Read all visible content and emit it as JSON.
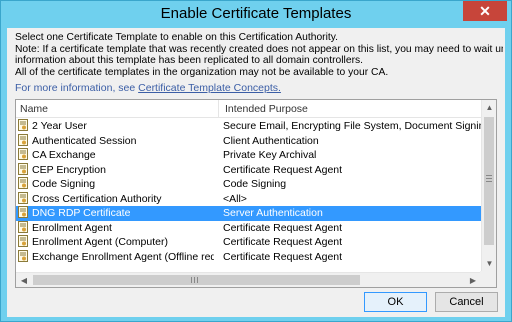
{
  "window": {
    "title": "Enable Certificate Templates",
    "close_glyph": "✕"
  },
  "description": {
    "lines": [
      "Select one Certificate Template to enable on this Certification Authority.",
      "Note: If a certificate template that was recently created does not appear on this list, you may need to wait until",
      "information about this template has been replicated to all domain controllers.",
      "All of the certificate templates in the organization may not be available to your CA."
    ],
    "more_info_prefix": "For more information, see ",
    "more_info_link": "Certificate Template Concepts."
  },
  "list": {
    "columns": [
      "Name",
      "Intended Purpose"
    ],
    "rows": [
      {
        "name": "2 Year User",
        "purpose": "Secure Email, Encrypting File System, Document Signing, Doc",
        "selected": false
      },
      {
        "name": "Authenticated Session",
        "purpose": "Client Authentication",
        "selected": false
      },
      {
        "name": "CA Exchange",
        "purpose": "Private Key Archival",
        "selected": false
      },
      {
        "name": "CEP Encryption",
        "purpose": "Certificate Request Agent",
        "selected": false
      },
      {
        "name": "Code Signing",
        "purpose": "Code Signing",
        "selected": false
      },
      {
        "name": "Cross Certification Authority",
        "purpose": "<All>",
        "selected": false
      },
      {
        "name": "DNG RDP Certificate",
        "purpose": "Server Authentication",
        "selected": true
      },
      {
        "name": "Enrollment Agent",
        "purpose": "Certificate Request Agent",
        "selected": false
      },
      {
        "name": "Enrollment Agent (Computer)",
        "purpose": "Certificate Request Agent",
        "selected": false
      },
      {
        "name": "Exchange Enrollment Agent (Offline request)",
        "purpose": "Certificate Request Agent",
        "selected": false
      }
    ],
    "row_icon": "certificate-template-icon"
  },
  "buttons": {
    "ok": "OK",
    "cancel": "Cancel"
  },
  "colors": {
    "title_bar": "#6fd0ee",
    "close_button": "#c7453a",
    "selection": "#3399ff",
    "link": "#3b5ea6"
  }
}
